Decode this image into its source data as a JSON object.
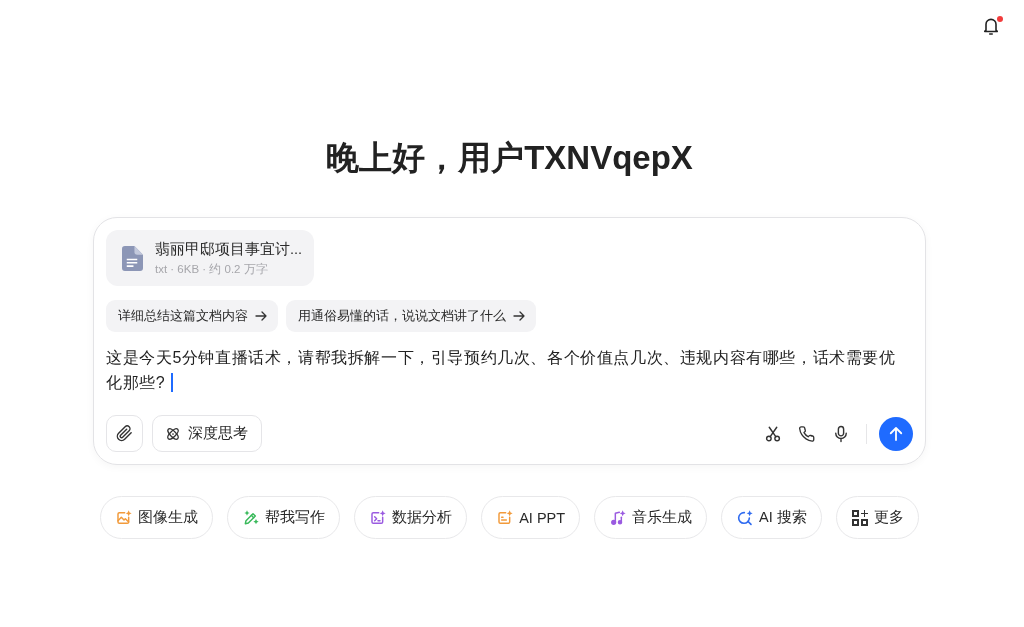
{
  "notifications": {
    "unread": true
  },
  "greeting": "晚上好，用户TXNVqepX",
  "composer": {
    "attachment": {
      "name": "翡丽甲邸项目事宜讨...",
      "meta": "txt · 6KB · 约 0.2 万字"
    },
    "suggestions": [
      "详细总结这篇文档内容",
      "用通俗易懂的话，说说文档讲了什么"
    ],
    "input_value": "这是今天5分钟直播话术，请帮我拆解一下，引导预约几次、各个价值点几次、违规内容有哪些，话术需要优化那些?",
    "deep_think": {
      "label": "深度思考",
      "selected": false
    }
  },
  "tools": [
    {
      "label": "图像生成",
      "kind": "image",
      "color": "#f29a3a"
    },
    {
      "label": "帮我写作",
      "kind": "write",
      "color": "#38b95a"
    },
    {
      "label": "数据分析",
      "kind": "data",
      "color": "#9a5ae0"
    },
    {
      "label": "AI PPT",
      "kind": "slides",
      "color": "#f29a3a"
    },
    {
      "label": "音乐生成",
      "kind": "music",
      "color": "#9a5ae0"
    },
    {
      "label": "AI 搜索",
      "kind": "search",
      "color": "#2f6bf0"
    },
    {
      "label": "更多",
      "kind": "more",
      "color": "#333333"
    }
  ]
}
